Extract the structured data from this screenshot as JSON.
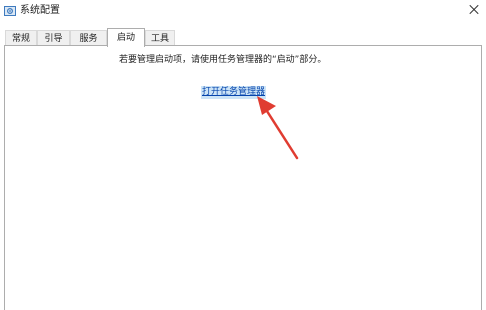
{
  "window": {
    "title": "系统配置",
    "icon": "gear-icon"
  },
  "tabs": [
    {
      "label": "常规",
      "active": false
    },
    {
      "label": "引导",
      "active": false
    },
    {
      "label": "服务",
      "active": false
    },
    {
      "label": "启动",
      "active": true
    },
    {
      "label": "工具",
      "active": false
    }
  ],
  "startup": {
    "info_text": "若要管理启动项，请使用任务管理器的“启动”部分。",
    "link_label": "打开任务管理器"
  },
  "colors": {
    "link": "#0645ad",
    "link_highlight": "#cce4f7",
    "annotation_arrow": "#e03c31"
  }
}
